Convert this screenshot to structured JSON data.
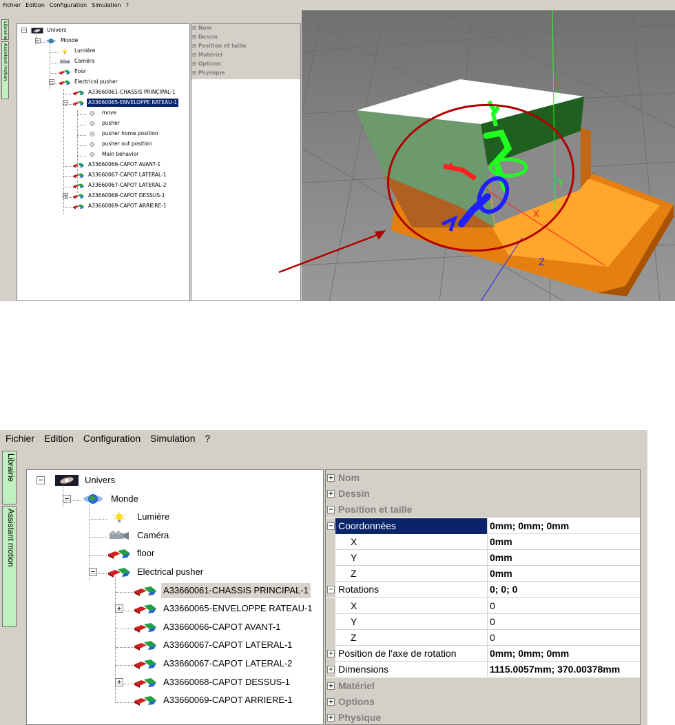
{
  "menu": [
    "Fichier",
    "Edition",
    "Configuration",
    "Simulation",
    "?"
  ],
  "side_tabs": [
    "Librairie",
    "Assistant motion"
  ],
  "top_tree": [
    {
      "label": "Univers",
      "icon": "galaxy-icon"
    },
    {
      "label": "Monde",
      "icon": "globe-icon"
    },
    {
      "label": "Lumière",
      "icon": "bulb-icon"
    },
    {
      "label": "Caméra",
      "icon": "camera-icon"
    },
    {
      "label": "floor",
      "icon": "part-icon"
    },
    {
      "label": "Electrical pusher",
      "icon": "part-icon"
    },
    {
      "label": "A33660061-CHASSIS PRINCIPAL-1",
      "icon": "part-icon"
    },
    {
      "label": "A33660065-ENVELOPPE RATEAU-1",
      "icon": "part-icon",
      "selected": true
    },
    {
      "label": "move",
      "icon": "gear-icon"
    },
    {
      "label": "pusher",
      "icon": "gear-icon"
    },
    {
      "label": "pusher home position",
      "icon": "gear-icon"
    },
    {
      "label": "pusher out position",
      "icon": "gear-icon"
    },
    {
      "label": "Main behavior",
      "icon": "gear-icon"
    },
    {
      "label": "A33660066-CAPOT AVANT-1",
      "icon": "part-icon"
    },
    {
      "label": "A33660067-CAPOT LATERAL-1",
      "icon": "part-icon"
    },
    {
      "label": "A33660067-CAPOT LATERAL-2",
      "icon": "part-icon"
    },
    {
      "label": "A33660068-CAPOT DESSUS-1",
      "icon": "part-icon"
    },
    {
      "label": "A33660069-CAPOT ARRIERE-1",
      "icon": "part-icon"
    }
  ],
  "top_props": [
    "Nom",
    "Dessin",
    "Position et taille",
    "Matériel",
    "Options",
    "Physique"
  ],
  "viewport": {
    "axes": {
      "x": "X",
      "y": "Y",
      "z": "Z"
    },
    "colors": {
      "x": "#ff2020",
      "y": "#20ff20",
      "z": "#2020ff",
      "annotation": "#b00000"
    }
  },
  "bottom_tree": [
    {
      "label": "Univers",
      "icon": "galaxy-icon"
    },
    {
      "label": "Monde",
      "icon": "globe-icon"
    },
    {
      "label": "Lumière",
      "icon": "bulb-icon"
    },
    {
      "label": "Caméra",
      "icon": "camera-icon"
    },
    {
      "label": "floor",
      "icon": "part-icon"
    },
    {
      "label": "Electrical pusher",
      "icon": "part-icon"
    },
    {
      "label": "A33660061-CHASSIS PRINCIPAL-1",
      "icon": "part-icon",
      "selected": true
    },
    {
      "label": "A33660065-ENVELOPPE RATEAU-1",
      "icon": "part-icon"
    },
    {
      "label": "A33660066-CAPOT AVANT-1",
      "icon": "part-icon"
    },
    {
      "label": "A33660067-CAPOT LATERAL-1",
      "icon": "part-icon"
    },
    {
      "label": "A33660067-CAPOT LATERAL-2",
      "icon": "part-icon"
    },
    {
      "label": "A33660068-CAPOT DESSUS-1",
      "icon": "part-icon"
    },
    {
      "label": "A33660069-CAPOT ARRIERE-1",
      "icon": "part-icon"
    }
  ],
  "bottom_props": [
    {
      "label": "Nom",
      "type": "category",
      "state": "collapsed"
    },
    {
      "label": "Dessin",
      "type": "category",
      "state": "collapsed"
    },
    {
      "label": "Position et taille",
      "type": "category",
      "state": "expanded"
    },
    {
      "label": "Coordonnées",
      "value": "0mm; 0mm; 0mm",
      "type": "item",
      "state": "expanded",
      "selected": true,
      "bold": true
    },
    {
      "label": "X",
      "value": "0mm",
      "type": "sub",
      "bold": true
    },
    {
      "label": "Y",
      "value": "0mm",
      "type": "sub",
      "bold": true
    },
    {
      "label": "Z",
      "value": "0mm",
      "type": "sub",
      "bold": true
    },
    {
      "label": "Rotations",
      "value": "0; 0; 0",
      "type": "item",
      "state": "expanded",
      "bold": true
    },
    {
      "label": "X",
      "value": "0",
      "type": "sub"
    },
    {
      "label": "Y",
      "value": "0",
      "type": "sub"
    },
    {
      "label": "Z",
      "value": "0",
      "type": "sub"
    },
    {
      "label": "Position de l'axe de rotation",
      "value": "0mm; 0mm; 0mm",
      "type": "item",
      "state": "collapsed",
      "bold": true
    },
    {
      "label": "Dimensions",
      "value": "1115.0057mm; 370.00378mm",
      "type": "item",
      "state": "collapsed",
      "bold": true
    },
    {
      "label": "Matériel",
      "type": "category",
      "state": "collapsed"
    },
    {
      "label": "Options",
      "type": "category",
      "state": "collapsed"
    },
    {
      "label": "Physique",
      "type": "category",
      "state": "collapsed"
    }
  ]
}
